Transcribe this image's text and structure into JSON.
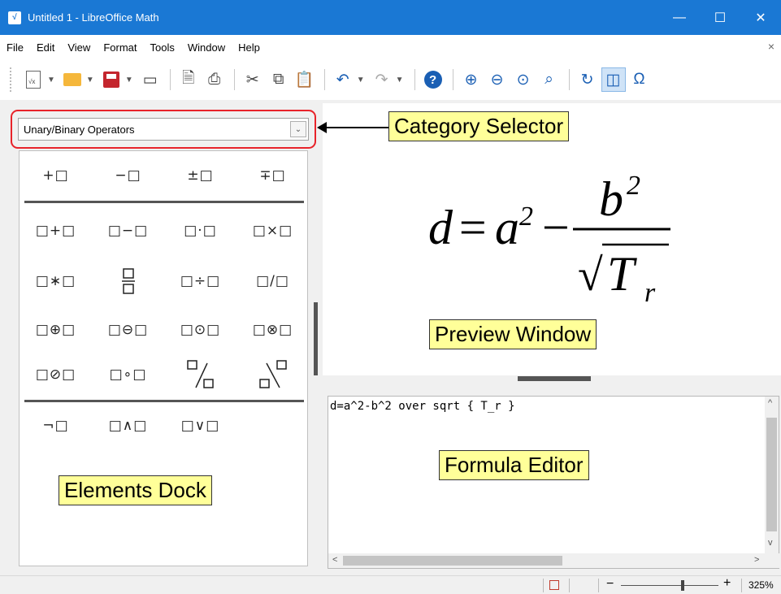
{
  "window": {
    "title": "Untitled 1 - LibreOffice Math",
    "controls": {
      "minimize": "—",
      "maximize": "☐",
      "close": "✕"
    }
  },
  "menu": [
    "File",
    "Edit",
    "View",
    "Format",
    "Tools",
    "Window",
    "Help"
  ],
  "menu_close": "×",
  "toolbar": {
    "icons": [
      "new-formula-icon",
      "open-folder-icon",
      "save-icon",
      "insert-icon",
      "export-pdf-icon",
      "print-icon",
      "cut-icon",
      "copy-icon",
      "paste-icon",
      "undo-icon",
      "redo-icon",
      "help-icon",
      "zoom-in-icon",
      "zoom-out-icon",
      "zoom-100-icon",
      "show-all-icon",
      "update-icon",
      "formula-cursor-icon",
      "symbols-icon"
    ],
    "omega": "Ω"
  },
  "category": {
    "selected": "Unary/Binary Operators",
    "arrow": "⌄"
  },
  "elements": {
    "unary": [
      "+□",
      "−□",
      "±□",
      "∓□"
    ],
    "binary_row1": [
      "□+□",
      "□−□",
      "□·□",
      "□×□"
    ],
    "binary_row2": [
      "□∗□",
      "□/□",
      "□÷□",
      "□/□"
    ],
    "binary_row3": [
      "□⊕□",
      "□⊖□",
      "□⊙□",
      "□⊗□"
    ],
    "binary_row4": [
      "□⊘□",
      "□∘□",
      "□⁄□",
      "□∖□"
    ],
    "logic": [
      "¬□",
      "□∧□",
      "□∨□"
    ]
  },
  "preview": {
    "lhs": "d",
    "equals": "=",
    "a": "a",
    "a_exp": "2",
    "minus": "−",
    "b": "b",
    "b_exp": "2",
    "sqrt": "√",
    "T": "T",
    "T_sub": "r"
  },
  "editor": {
    "text": "d=a^2-b^2 over sqrt { T_r }"
  },
  "status": {
    "zoom": "325%",
    "minus": "−",
    "plus": "+"
  },
  "callouts": {
    "category_selector": "Category Selector",
    "preview_window": "Preview Window",
    "formula_editor": "Formula Editor",
    "elements_dock": "Elements Dock"
  },
  "colors": {
    "titlebar": "#1a78d4",
    "highlight_border": "#e8232a",
    "callout_bg": "#ffff99"
  }
}
